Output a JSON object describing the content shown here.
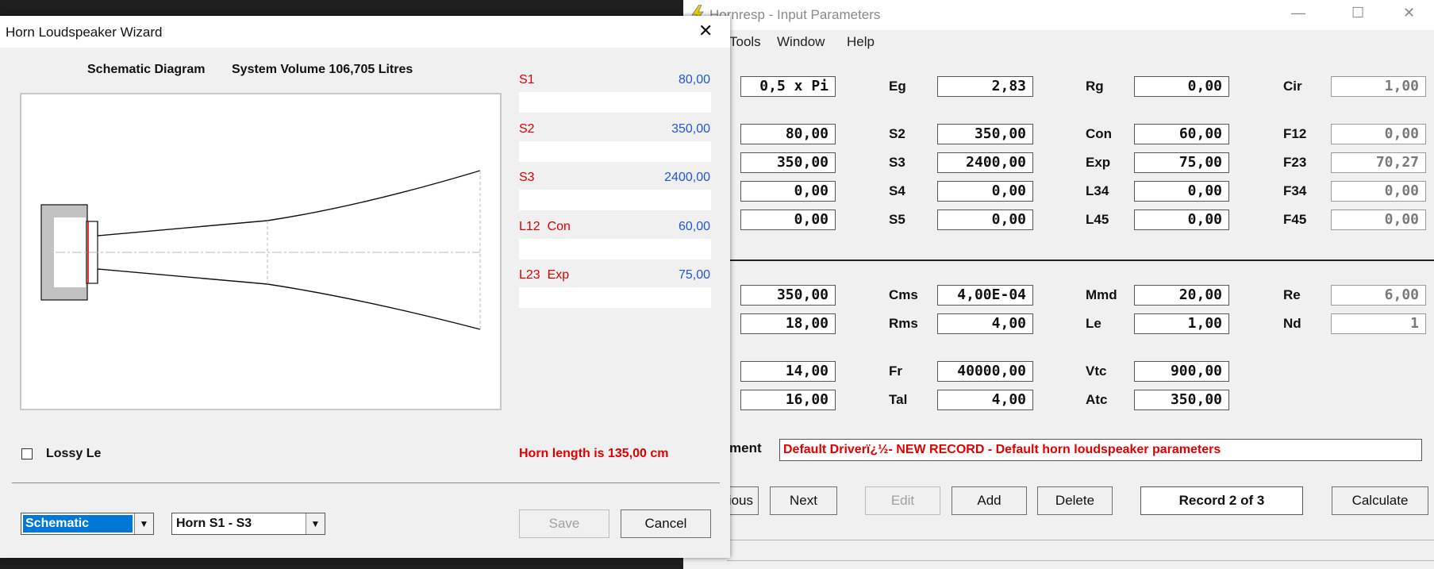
{
  "hornresp": {
    "title": "Hornresp - Input Parameters",
    "menu": [
      "Tools",
      "Window",
      "Help"
    ],
    "window_controls": {
      "minimize": "—",
      "maximize": "☐",
      "close": "✕"
    },
    "rows": [
      {
        "c1": "0,5 x Pi",
        "l2": "Eg",
        "c2": "2,83",
        "l3": "Rg",
        "c3": "0,00",
        "l4": "Cir",
        "c4": "1,00"
      },
      {
        "c1": "80,00",
        "l2": "S2",
        "c2": "350,00",
        "l3": "Con",
        "c3": "60,00",
        "l4": "F12",
        "c4": "0,00"
      },
      {
        "c1": "350,00",
        "l2": "S3",
        "c2": "2400,00",
        "l3": "Exp",
        "c3": "75,00",
        "l4": "F23",
        "c4": "70,27"
      },
      {
        "c1": "0,00",
        "l2": "S4",
        "c2": "0,00",
        "l3": "L34",
        "c3": "0,00",
        "l4": "F34",
        "c4": "0,00"
      },
      {
        "c1": "0,00",
        "l2": "S5",
        "c2": "0,00",
        "l3": "L45",
        "c3": "0,00",
        "l4": "F45",
        "c4": "0,00"
      },
      {
        "c1": "350,00",
        "l2": "Cms",
        "c2": "4,00E-04",
        "l3": "Mmd",
        "c3": "20,00",
        "l4": "Re",
        "c4": "6,00"
      },
      {
        "c1": "18,00",
        "l2": "Rms",
        "c2": "4,00",
        "l3": "Le",
        "c3": "1,00",
        "l4": "Nd",
        "c4": "1"
      },
      {
        "c1": "14,00",
        "l2": "Fr",
        "c2": "40000,00",
        "l3": "Vtc",
        "c3": "900,00"
      },
      {
        "c1": "16,00",
        "l2": "Tal",
        "c2": "4,00",
        "l3": "Atc",
        "c3": "350,00"
      }
    ],
    "comment_label": "ment",
    "comment_value": "Default Driverï¿½- NEW RECORD - Default horn loudspeaker parameters",
    "buttons": {
      "previous": "ious",
      "next": "Next",
      "edit": "Edit",
      "add": "Add",
      "delete": "Delete",
      "calculate": "Calculate"
    },
    "record": "Record 2 of 3"
  },
  "wizard": {
    "title": "Horn Loudspeaker Wizard",
    "close": "✕",
    "caption_left": "Schematic Diagram",
    "caption_right": "System Volume 106,705 Litres",
    "params": [
      {
        "label": "S1",
        "value": "80,00"
      },
      {
        "label": "S2",
        "value": "350,00"
      },
      {
        "label": "S3",
        "value": "2400,00"
      },
      {
        "label": "L12  Con",
        "value": "60,00"
      },
      {
        "label": "L23  Exp",
        "value": "75,00"
      }
    ],
    "lossy_le": "Lossy Le",
    "horn_length": "Horn length is 135,00 cm",
    "view_select": "Schematic",
    "horn_select": "Horn S1 - S3",
    "save": "Save",
    "cancel": "Cancel",
    "accent": "#0078d7",
    "label_color": "#e00000",
    "value_color": "#2255dd"
  }
}
